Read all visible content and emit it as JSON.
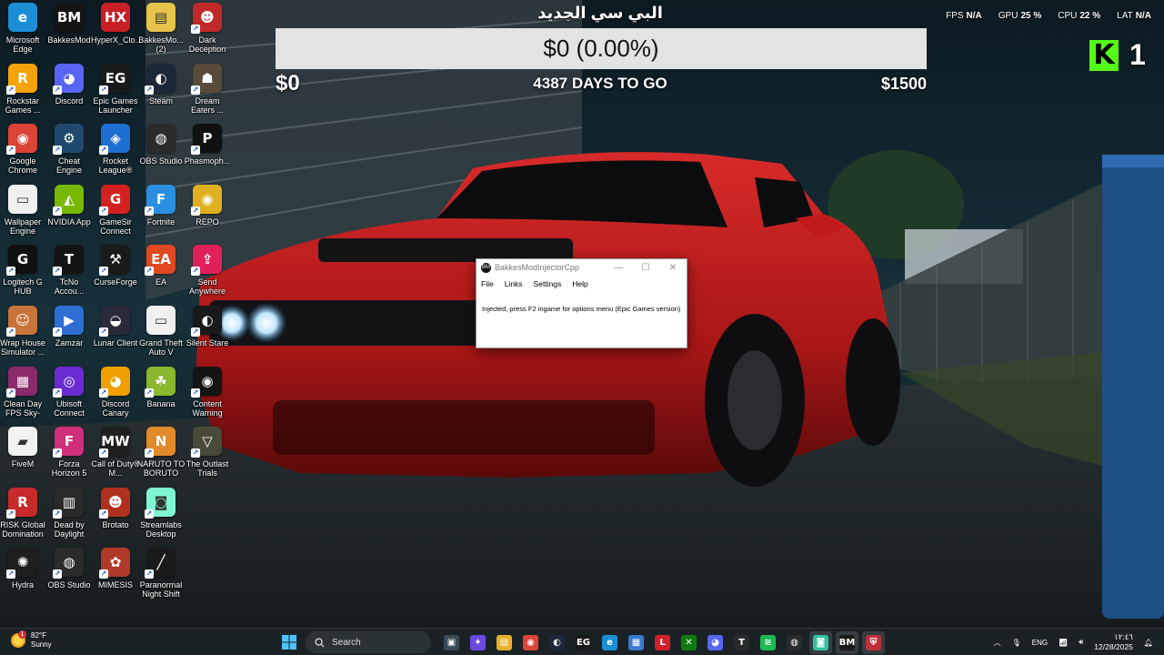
{
  "overlay": {
    "title": "البي سي الجديد",
    "progress_text": "$0 (0.00%)",
    "progress_fraction": 0,
    "start_amount": "$0",
    "days_to_go": "4387 DAYS TO GO",
    "goal_amount": "$1500"
  },
  "stats": [
    {
      "label": "FPS",
      "value": "N/A"
    },
    {
      "label": "GPU",
      "value": "25 %"
    },
    {
      "label": "CPU",
      "value": "22 %"
    },
    {
      "label": "LAT",
      "value": "N/A"
    }
  ],
  "kick": {
    "logo": "K",
    "count": "1",
    "color": "#53fc18"
  },
  "desktop_icons": [
    {
      "label": "Microsoft Edge",
      "glyph": "e",
      "color": "#1a8fd6",
      "icon": "edge-icon",
      "shortcut": false
    },
    {
      "label": "Rockstar Games ...",
      "glyph": "R",
      "color": "#f5a30a",
      "icon": "rockstar-icon",
      "shortcut": true
    },
    {
      "label": "Google Chrome",
      "glyph": "◉",
      "color": "#db4437",
      "icon": "chrome-icon",
      "shortcut": true
    },
    {
      "label": "Wallpaper Engine",
      "glyph": "▭",
      "color": "#f0f0f0",
      "icon": "file-icon",
      "shortcut": false
    },
    {
      "label": "Logitech G HUB",
      "glyph": "G",
      "color": "#111111",
      "icon": "logitech-icon",
      "shortcut": true
    },
    {
      "label": "Wrap House Simulator ...",
      "glyph": "☺",
      "color": "#c8743a",
      "icon": "wrap-house-icon",
      "shortcut": true
    },
    {
      "label": "Clean Day FPS Sky-Pa...",
      "glyph": "▦",
      "color": "#8a2a6a",
      "icon": "winrar-icon",
      "shortcut": true
    },
    {
      "label": "FiveM",
      "glyph": "▰",
      "color": "#f2f2f2",
      "icon": "fivem-icon",
      "shortcut": false
    },
    {
      "label": "RISK Global Domination",
      "glyph": "R",
      "color": "#c62a2a",
      "icon": "risk-icon",
      "shortcut": true
    },
    {
      "label": "Hydra",
      "glyph": "✺",
      "color": "#1e1e1e",
      "icon": "hydra-icon",
      "shortcut": true
    },
    {
      "label": "BakkesMod",
      "glyph": "BM",
      "color": "#141414",
      "icon": "bakkesmod-icon",
      "shortcut": false
    },
    {
      "label": "Discord",
      "glyph": "◕",
      "color": "#5865f2",
      "icon": "discord-icon",
      "shortcut": true
    },
    {
      "label": "Cheat Engine",
      "glyph": "⚙",
      "color": "#1f4a6e",
      "icon": "cheat-engine-icon",
      "shortcut": true
    },
    {
      "label": "NVIDIA App",
      "glyph": "◭",
      "color": "#76b900",
      "icon": "nvidia-icon",
      "shortcut": true
    },
    {
      "label": "TcNo Accou...",
      "glyph": "T",
      "color": "#141414",
      "icon": "tcno-icon",
      "shortcut": true
    },
    {
      "label": "Zamzar",
      "glyph": "▶",
      "color": "#2f6ed3",
      "icon": "zamzar-icon",
      "shortcut": true
    },
    {
      "label": "Ubisoft Connect",
      "glyph": "◎",
      "color": "#6a2bd0",
      "icon": "ubisoft-icon",
      "shortcut": true
    },
    {
      "label": "Forza Horizon 5",
      "glyph": "F",
      "color": "#d0307a",
      "icon": "forza-icon",
      "shortcut": true
    },
    {
      "label": "Dead by Daylight",
      "glyph": "▥",
      "color": "#2a2a2a",
      "icon": "dbd-icon",
      "shortcut": true
    },
    {
      "label": "OBS Studio",
      "glyph": "◍",
      "color": "#2b2b2b",
      "icon": "obs-icon",
      "shortcut": true
    },
    {
      "label": "HyperX_Clo...",
      "glyph": "HX",
      "color": "#c81f26",
      "icon": "hyperx-icon",
      "shortcut": false
    },
    {
      "label": "Epic Games Launcher",
      "glyph": "EG",
      "color": "#1a1a1a",
      "icon": "epic-games-icon",
      "shortcut": true
    },
    {
      "label": "Rocket League®",
      "glyph": "◈",
      "color": "#1d6fd1",
      "icon": "rocket-league-icon",
      "shortcut": true
    },
    {
      "label": "GameSir Connect",
      "glyph": "G",
      "color": "#d32020",
      "icon": "gamesir-icon",
      "shortcut": true
    },
    {
      "label": "CurseForge",
      "glyph": "⚒",
      "color": "#1a1a1a",
      "icon": "curseforge-icon",
      "shortcut": true
    },
    {
      "label": "Lunar Client",
      "glyph": "◒",
      "color": "#2a2a3a",
      "icon": "lunar-client-icon",
      "shortcut": true
    },
    {
      "label": "Discord Canary",
      "glyph": "◕",
      "color": "#f0a000",
      "icon": "discord-canary-icon",
      "shortcut": true
    },
    {
      "label": "Call of Duty® M...",
      "glyph": "MW",
      "color": "#202020",
      "icon": "cod-icon",
      "shortcut": true
    },
    {
      "label": "Brotato",
      "glyph": "☻",
      "color": "#b03020",
      "icon": "brotato-icon",
      "shortcut": true
    },
    {
      "label": "MIMESIS",
      "glyph": "✿",
      "color": "#b03a2a",
      "icon": "mimesis-icon",
      "shortcut": true
    },
    {
      "label": "BakkesMo... (2)",
      "glyph": "▤",
      "color": "#e6c34a",
      "icon": "folder-icon",
      "shortcut": false
    },
    {
      "label": "Steam",
      "glyph": "◐",
      "color": "#1b2838",
      "icon": "steam-icon",
      "shortcut": true
    },
    {
      "label": "OBS Studio",
      "glyph": "◍",
      "color": "#2b2b2b",
      "icon": "obs-icon",
      "shortcut": false
    },
    {
      "label": "Fortnite",
      "glyph": "F",
      "color": "#2a8fe0",
      "icon": "fortnite-icon",
      "shortcut": true
    },
    {
      "label": "EA",
      "glyph": "EA",
      "color": "#e0481f",
      "icon": "ea-icon",
      "shortcut": true
    },
    {
      "label": "Grand Theft Auto V",
      "glyph": "▭",
      "color": "#f0f0f0",
      "icon": "file-icon",
      "shortcut": false
    },
    {
      "label": "Banana",
      "glyph": "☘",
      "color": "#8ab82e",
      "icon": "banana-icon",
      "shortcut": true
    },
    {
      "label": "NARUTO TO BORUTO S...",
      "glyph": "N",
      "color": "#e08a2a",
      "icon": "naruto-icon",
      "shortcut": true
    },
    {
      "label": "Streamlabs Desktop",
      "glyph": "◙",
      "color": "#80f5d2",
      "icon": "streamlabs-icon",
      "shortcut": true
    },
    {
      "label": "Paranormal Night Shift",
      "glyph": "╱",
      "color": "#1a1a1a",
      "icon": "paranormal-icon",
      "shortcut": true
    },
    {
      "label": "Dark Deception",
      "glyph": "☻",
      "color": "#c02a2a",
      "icon": "dark-deception-icon",
      "shortcut": true
    },
    {
      "label": "Dream Eaters ...",
      "glyph": "☗",
      "color": "#5a4a3a",
      "icon": "dream-eaters-icon",
      "shortcut": true
    },
    {
      "label": "Phasmoph...",
      "glyph": "P",
      "color": "#111111",
      "icon": "phasmophobia-icon",
      "shortcut": true
    },
    {
      "label": "REPO",
      "glyph": "◉",
      "color": "#e0b020",
      "icon": "repo-icon",
      "shortcut": true
    },
    {
      "label": "Send Anywhere",
      "glyph": "⇪",
      "color": "#e0205a",
      "icon": "send-anywhere-icon",
      "shortcut": true
    },
    {
      "label": "Silent Stare",
      "glyph": "◐",
      "color": "#1a1a1a",
      "icon": "silent-stare-icon",
      "shortcut": true
    },
    {
      "label": "Content Warning",
      "glyph": "◉",
      "color": "#141414",
      "icon": "content-warning-icon",
      "shortcut": true
    },
    {
      "label": "The Outlast Trials",
      "glyph": "▽",
      "color": "#4a4a3a",
      "icon": "outlast-icon",
      "shortcut": true
    }
  ],
  "injector": {
    "title": "BakkesModInjectorCpp",
    "icon_glyph": "BM",
    "menu": [
      "File",
      "Links",
      "Settings",
      "Help"
    ],
    "message": "Injected, press F2 ingame for options menu (Epic Games version)",
    "min_glyph": "—",
    "max_glyph": "☐",
    "close_glyph": "✕"
  },
  "taskbar": {
    "weather": {
      "temp": "82°F",
      "condition": "Sunny",
      "badge": "1"
    },
    "start_icon": "windows-start-icon",
    "search_placeholder": "Search",
    "pinned": [
      {
        "icon": "task-view-icon",
        "glyph": "▣",
        "color": "#3a4a55",
        "active": false
      },
      {
        "icon": "copilot-icon",
        "glyph": "✦",
        "color": "#6a4ae0",
        "active": false
      },
      {
        "icon": "file-explorer-icon",
        "glyph": "▤",
        "color": "#e6b02a",
        "active": false
      },
      {
        "icon": "chrome-icon",
        "glyph": "◉",
        "color": "#db4437",
        "active": false
      },
      {
        "icon": "steam-icon",
        "glyph": "◐",
        "color": "#1b2838",
        "active": false
      },
      {
        "icon": "epic-games-icon",
        "glyph": "EG",
        "color": "#1a1a1a",
        "active": false
      },
      {
        "icon": "edge-icon",
        "glyph": "e",
        "color": "#1a8fd6",
        "active": false
      },
      {
        "icon": "microsoft-store-icon",
        "glyph": "▦",
        "color": "#3a7ad0",
        "active": false
      },
      {
        "icon": "l-app-icon",
        "glyph": "L",
        "color": "#d0202a",
        "active": false
      },
      {
        "icon": "xbox-icon",
        "glyph": "✕",
        "color": "#107c10",
        "active": false
      },
      {
        "icon": "discord-icon",
        "glyph": "◕",
        "color": "#5865f2",
        "active": false
      },
      {
        "icon": "tcno-icon",
        "glyph": "T",
        "color": "#2a2a2a",
        "active": false
      },
      {
        "icon": "spotify-icon",
        "glyph": "≋",
        "color": "#1db954",
        "active": false
      },
      {
        "icon": "obs-icon",
        "glyph": "◍",
        "color": "#2b2b2b",
        "active": false
      },
      {
        "icon": "streamlabs-icon",
        "glyph": "◙",
        "color": "#2fc2a0",
        "active": true
      },
      {
        "icon": "bakkesmod-icon",
        "glyph": "BM",
        "color": "#1a1a1a",
        "active": true
      },
      {
        "icon": "shield-icon",
        "glyph": "⛨",
        "color": "#c0303a",
        "active": true
      }
    ],
    "tray": {
      "language": "ENG",
      "time": "١٢:٤٦",
      "date": "12/28/2025"
    }
  }
}
